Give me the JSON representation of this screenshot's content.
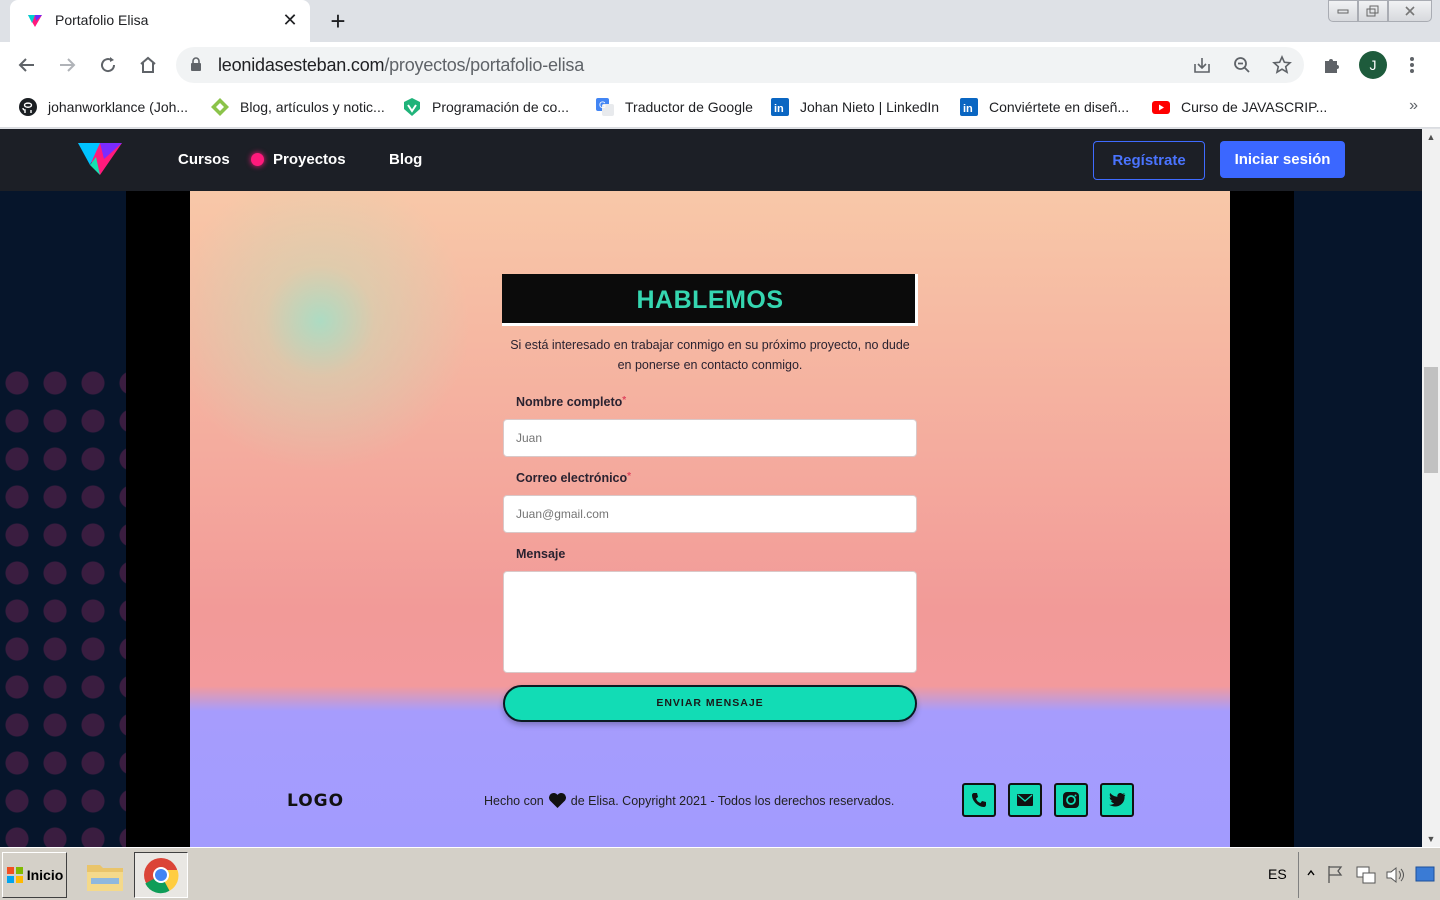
{
  "browser": {
    "tab_title": "Portafolio Elisa",
    "tab_close": "✕",
    "new_tab": "+",
    "url_domain": "leonidasesteban.com",
    "url_path": "/proyectos/portafolio-elisa",
    "profile_initial": "J",
    "bookmarks": [
      {
        "label": "johanworklance (Joh...",
        "icon": "github-icon"
      },
      {
        "label": "Blog, artículos y notic...",
        "icon": "diamond-icon"
      },
      {
        "label": "Programación de co...",
        "icon": "vue-shield-icon"
      },
      {
        "label": "Traductor de Google",
        "icon": "google-translate-icon"
      },
      {
        "label": "Johan Nieto | LinkedIn",
        "icon": "linkedin-icon"
      },
      {
        "label": "Conviértete en diseñ...",
        "icon": "linkedin-icon"
      },
      {
        "label": "Curso de JAVASCRIP...",
        "icon": "youtube-icon"
      }
    ],
    "bookmarks_more": "»"
  },
  "site_nav": {
    "links": [
      "Cursos",
      "Proyectos",
      "Blog"
    ],
    "register_label": "Regístrate",
    "login_label": "Iniciar sesión"
  },
  "contact": {
    "title": "HABLEMOS",
    "intro_line1": "Si está interesado en trabajar conmigo en su próximo proyecto, no dude",
    "intro_line2": "en ponerse en contacto conmigo.",
    "name_label": "Nombre completo",
    "name_placeholder": "Juan",
    "email_label": "Correo electrónico",
    "email_placeholder": "Juan@gmail.com",
    "message_label": "Mensaje",
    "required_mark": "*",
    "send_label": "ENVIAR MENSAJE"
  },
  "footer": {
    "logo": "LOGO",
    "credit_before": "Hecho con",
    "credit_after": "de Elisa. Copyright 2021 - Todos los derechos reservados.",
    "social_icons": [
      "phone-icon",
      "mail-icon",
      "instagram-icon",
      "twitter-icon"
    ]
  },
  "taskbar": {
    "start_label": "Inicio",
    "language": "ES"
  },
  "colors": {
    "accent_teal": "#12dcb5",
    "brand_blue": "#3b67ff",
    "nav_dot_pink": "#ff1a7c"
  }
}
